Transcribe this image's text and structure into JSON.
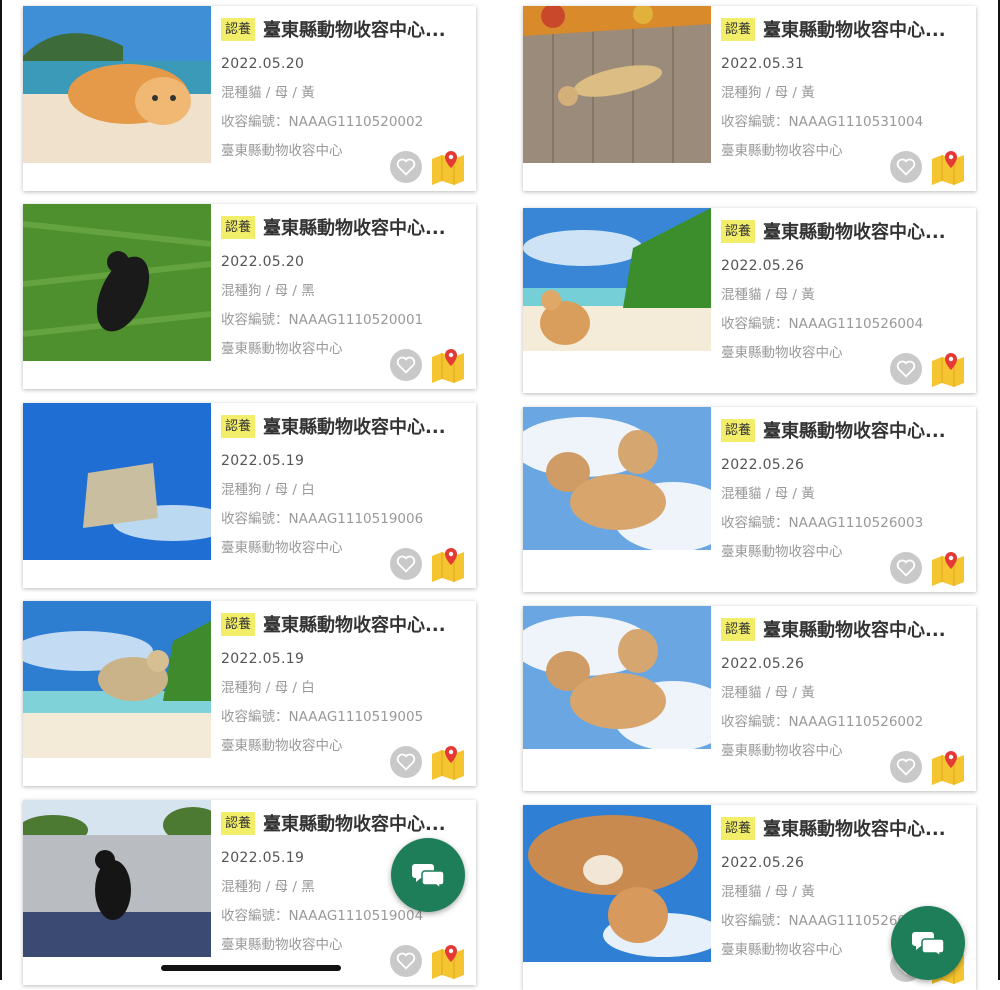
{
  "badge_label": "認養",
  "icons": {
    "favorite": "heart-icon",
    "location": "map-pin-icon",
    "chat": "chat-bubbles-icon"
  },
  "colors": {
    "badge": "#f3ee6a",
    "chat_button": "#1f7e5a",
    "pin": "#e53935",
    "map": "#f5c431"
  },
  "left_cards": [
    {
      "shelter": "臺東縣動物收容中心...",
      "date": "2022.05.20",
      "desc": "混種貓 / 母 / 黃",
      "code": "收容編號：NAAAG1110520002",
      "location": "臺東縣動物收容中心"
    },
    {
      "shelter": "臺東縣動物收容中心...",
      "date": "2022.05.20",
      "desc": "混種狗 / 母 / 黑",
      "code": "收容編號：NAAAG1110520001",
      "location": "臺東縣動物收容中心"
    },
    {
      "shelter": "臺東縣動物收容中心...",
      "date": "2022.05.19",
      "desc": "混種狗 / 母 / 白",
      "code": "收容編號：NAAAG1110519006",
      "location": "臺東縣動物收容中心"
    },
    {
      "shelter": "臺東縣動物收容中心...",
      "date": "2022.05.19",
      "desc": "混種狗 / 母 / 白",
      "code": "收容編號：NAAAG1110519005",
      "location": "臺東縣動物收容中心"
    },
    {
      "shelter": "臺東縣動物收容中心...",
      "date": "2022.05.19",
      "desc": "混種狗 / 母 / 黑",
      "code": "收容編號：NAAAG1110519004",
      "location": "臺東縣動物收容中心"
    }
  ],
  "right_cards": [
    {
      "shelter": "臺東縣動物收容中心...",
      "date": "2022.05.31",
      "desc": "混種狗 / 母 / 黃",
      "code": "收容編號：NAAAG1110531004",
      "location": "臺東縣動物收容中心"
    },
    {
      "shelter": "臺東縣動物收容中心...",
      "date": "2022.05.26",
      "desc": "混種貓 / 母 / 黃",
      "code": "收容編號：NAAAG1110526004",
      "location": "臺東縣動物收容中心"
    },
    {
      "shelter": "臺東縣動物收容中心...",
      "date": "2022.05.26",
      "desc": "混種貓 / 母 / 黃",
      "code": "收容編號：NAAAG1110526003",
      "location": "臺東縣動物收容中心"
    },
    {
      "shelter": "臺東縣動物收容中心...",
      "date": "2022.05.26",
      "desc": "混種貓 / 母 / 黃",
      "code": "收容編號：NAAAG1110526002",
      "location": "臺東縣動物收容中心"
    },
    {
      "shelter": "臺東縣動物收容中心...",
      "date": "2022.05.26",
      "desc": "混種貓 / 母 / 黃",
      "code": "收容編號：NAAAG1110526001",
      "location": "臺東縣動物收容中心"
    }
  ]
}
